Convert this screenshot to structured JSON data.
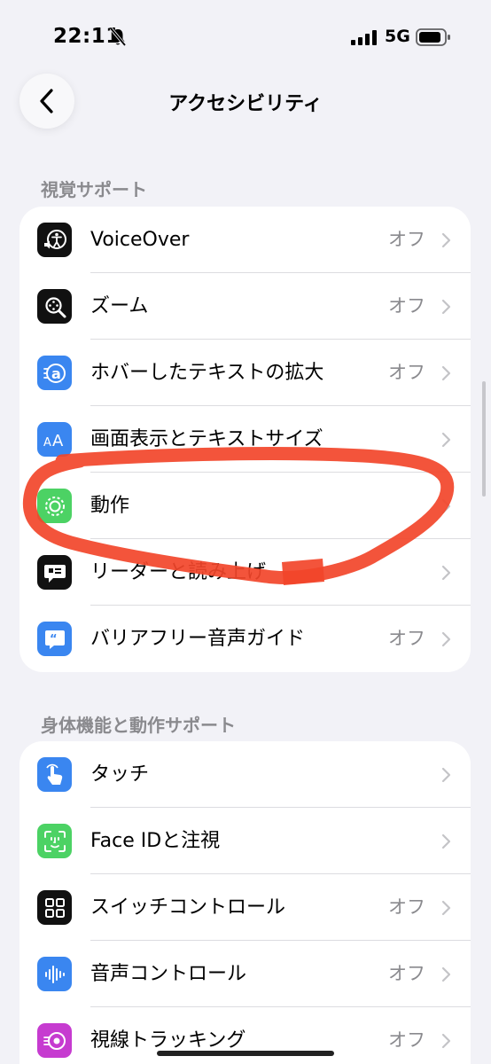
{
  "status_bar": {
    "time": "22:11",
    "network": "5G"
  },
  "nav": {
    "title": "アクセシビリティ"
  },
  "sections": [
    {
      "header": "視覚サポート",
      "rows": [
        {
          "label": "VoiceOver",
          "value": "オフ",
          "icon": "voiceover-icon"
        },
        {
          "label": "ズーム",
          "value": "オフ",
          "icon": "zoom-icon"
        },
        {
          "label": "ホバーしたテキストの拡大",
          "value": "オフ",
          "icon": "hover-text-icon"
        },
        {
          "label": "画面表示とテキストサイズ",
          "value": "",
          "icon": "text-size-icon"
        },
        {
          "label": "動作",
          "value": "",
          "icon": "motion-icon"
        },
        {
          "label": "リーダーと読み上げ",
          "value": "",
          "icon": "spoken-content-icon"
        },
        {
          "label": "バリアフリー音声ガイド",
          "value": "オフ",
          "icon": "audio-descriptions-icon"
        }
      ]
    },
    {
      "header": "身体機能と動作サポート",
      "rows": [
        {
          "label": "タッチ",
          "value": "",
          "icon": "touch-icon"
        },
        {
          "label": "Face IDと注視",
          "value": "",
          "icon": "face-id-icon"
        },
        {
          "label": "スイッチコントロール",
          "value": "オフ",
          "icon": "switch-control-icon"
        },
        {
          "label": "音声コントロール",
          "value": "オフ",
          "icon": "voice-control-icon"
        },
        {
          "label": "視線トラッキング",
          "value": "オフ",
          "icon": "eye-tracking-icon"
        }
      ]
    }
  ],
  "colors": {
    "accent_blue": "#3a86f0",
    "green": "#4cd264",
    "purple": "#c63bd0",
    "annotation_red": "#f2452a"
  }
}
